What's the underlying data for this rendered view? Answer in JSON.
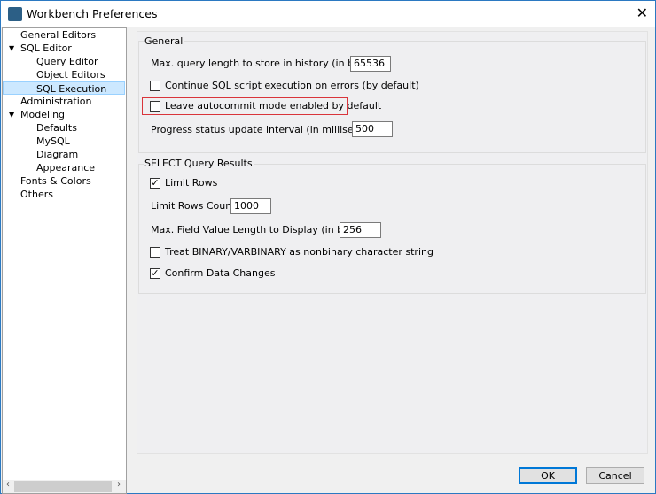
{
  "window": {
    "title": "Workbench Preferences",
    "close": "✕"
  },
  "sidebar": {
    "items": [
      {
        "label": "General Editors",
        "level": 0
      },
      {
        "label": "SQL Editor",
        "level": 0,
        "expanded": true
      },
      {
        "label": "Query Editor",
        "level": 1
      },
      {
        "label": "Object Editors",
        "level": 1
      },
      {
        "label": "SQL Execution",
        "level": 1,
        "selected": true
      },
      {
        "label": "Administration",
        "level": 0
      },
      {
        "label": "Modeling",
        "level": 0,
        "expanded": true
      },
      {
        "label": "Defaults",
        "level": 1
      },
      {
        "label": "MySQL",
        "level": 1
      },
      {
        "label": "Diagram",
        "level": 1
      },
      {
        "label": "Appearance",
        "level": 1
      },
      {
        "label": "Fonts & Colors",
        "level": 0
      },
      {
        "label": "Others",
        "level": 0
      }
    ],
    "expand_glyph": "▼",
    "scroll_left": "‹",
    "scroll_right": "›"
  },
  "general": {
    "title": "General",
    "max_query_label": "Max. query length to store in history (in bytes):",
    "max_query_value": "65536",
    "continue_label": "Continue SQL script execution on errors (by default)",
    "continue_checked": false,
    "autocommit_label": "Leave autocommit mode enabled by default",
    "autocommit_checked": false,
    "progress_label": "Progress status update interval (in milliseconds):",
    "progress_value": "500"
  },
  "select": {
    "title": "SELECT Query Results",
    "limit_rows_label": "Limit Rows",
    "limit_rows_checked": true,
    "check": "✓",
    "limit_count_label": "Limit Rows Count:",
    "limit_count_value": "1000",
    "max_field_label": "Max. Field Value Length to Display (in bytes):",
    "max_field_value": "256",
    "treat_binary_label": "Treat BINARY/VARBINARY as nonbinary character string",
    "treat_binary_checked": false,
    "confirm_label": "Confirm Data Changes",
    "confirm_checked": true
  },
  "buttons": {
    "ok": "OK",
    "cancel": "Cancel"
  },
  "colors": {
    "accent": "#0078d7",
    "highlight": "#d9343b",
    "selection": "#cce8ff"
  }
}
